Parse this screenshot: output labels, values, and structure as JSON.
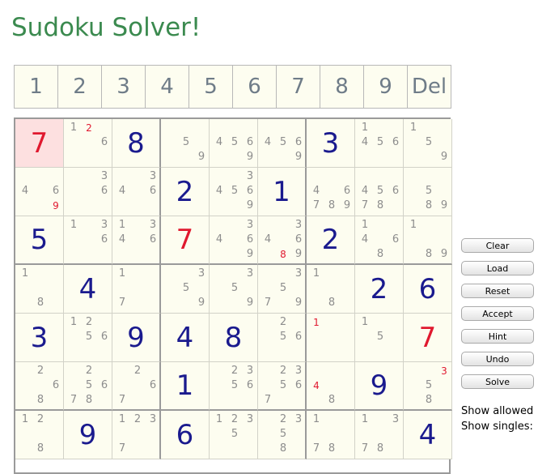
{
  "title": "Sudoku Solver!",
  "palette": [
    "1",
    "2",
    "3",
    "4",
    "5",
    "6",
    "7",
    "8",
    "9",
    "Del"
  ],
  "grid": [
    [
      {
        "v": "7",
        "red": true,
        "sel": true
      },
      {
        "c": [
          1,
          6
        ],
        "r": [
          2
        ]
      },
      {
        "v": "8"
      },
      {
        "c": [
          5,
          9
        ]
      },
      {
        "c": [
          4,
          5,
          6,
          9
        ]
      },
      {
        "c": [
          4,
          5,
          6,
          9
        ]
      },
      {
        "v": "3"
      },
      {
        "c": [
          1,
          4,
          5,
          6
        ]
      },
      {
        "c": [
          1,
          5,
          9
        ]
      }
    ],
    [
      {
        "c": [
          4,
          6
        ],
        "r": [
          9
        ]
      },
      {
        "c": [
          3,
          6
        ]
      },
      {
        "c": [
          3,
          4,
          6
        ]
      },
      {
        "v": "2"
      },
      {
        "c": [
          3,
          4,
          5,
          6,
          9
        ]
      },
      {
        "v": "1"
      },
      {
        "c": [
          4,
          6,
          7,
          8,
          9
        ]
      },
      {
        "c": [
          4,
          5,
          6,
          7,
          8
        ]
      },
      {
        "c": [
          5,
          8,
          9
        ]
      }
    ],
    [
      {
        "v": "5"
      },
      {
        "c": [
          1,
          3,
          6
        ]
      },
      {
        "c": [
          1,
          3,
          4,
          6
        ]
      },
      {
        "v": "7",
        "red": true
      },
      {
        "c": [
          3,
          4,
          6,
          9
        ]
      },
      {
        "c": [
          3,
          4,
          6,
          9
        ],
        "r": [
          8
        ]
      },
      {
        "v": "2"
      },
      {
        "c": [
          1,
          4,
          6,
          8
        ]
      },
      {
        "c": [
          1,
          8,
          9
        ]
      }
    ],
    [
      {
        "c": [
          1,
          8
        ]
      },
      {
        "v": "4"
      },
      {
        "c": [
          1,
          7
        ]
      },
      {
        "c": [
          3,
          5,
          9
        ]
      },
      {
        "c": [
          3,
          5,
          9
        ]
      },
      {
        "c": [
          3,
          5,
          7,
          9
        ]
      },
      {
        "c": [
          1,
          8
        ]
      },
      {
        "v": "2"
      },
      {
        "v": "6"
      }
    ],
    [
      {
        "v": "3"
      },
      {
        "c": [
          1,
          2,
          5,
          6
        ]
      },
      {
        "v": "9"
      },
      {
        "v": "4"
      },
      {
        "v": "8"
      },
      {
        "c": [
          2,
          5,
          6
        ]
      },
      {
        "c": [],
        "r": [
          1
        ]
      },
      {
        "c": [
          1,
          5
        ]
      },
      {
        "v": "7",
        "red": true
      }
    ],
    [
      {
        "c": [
          2,
          6,
          8
        ]
      },
      {
        "c": [
          2,
          5,
          6,
          7,
          8
        ]
      },
      {
        "c": [
          2,
          6,
          7
        ]
      },
      {
        "v": "1"
      },
      {
        "c": [
          2,
          3,
          5,
          6
        ]
      },
      {
        "c": [
          2,
          3,
          5,
          6,
          7
        ]
      },
      {
        "c": [
          8
        ],
        "r": [
          4
        ]
      },
      {
        "v": "9"
      },
      {
        "c": [
          5,
          8
        ],
        "r": [
          3
        ]
      }
    ],
    [
      {
        "c": [
          1,
          2,
          8
        ]
      },
      {
        "v": "9"
      },
      {
        "c": [
          1,
          2,
          3,
          7
        ]
      },
      {
        "v": "6"
      },
      {
        "c": [
          1,
          2,
          3,
          5
        ]
      },
      {
        "c": [
          2,
          3,
          5,
          8
        ]
      },
      {
        "c": [
          1,
          7,
          8
        ]
      },
      {
        "c": [
          1,
          3,
          7,
          8
        ]
      },
      {
        "v": "4"
      }
    ]
  ],
  "buttons": [
    "Clear",
    "Load",
    "Reset",
    "Accept",
    "Hint",
    "Undo",
    "Solve"
  ],
  "show_allowed": "Show allowed",
  "show_singles": "Show singles:"
}
